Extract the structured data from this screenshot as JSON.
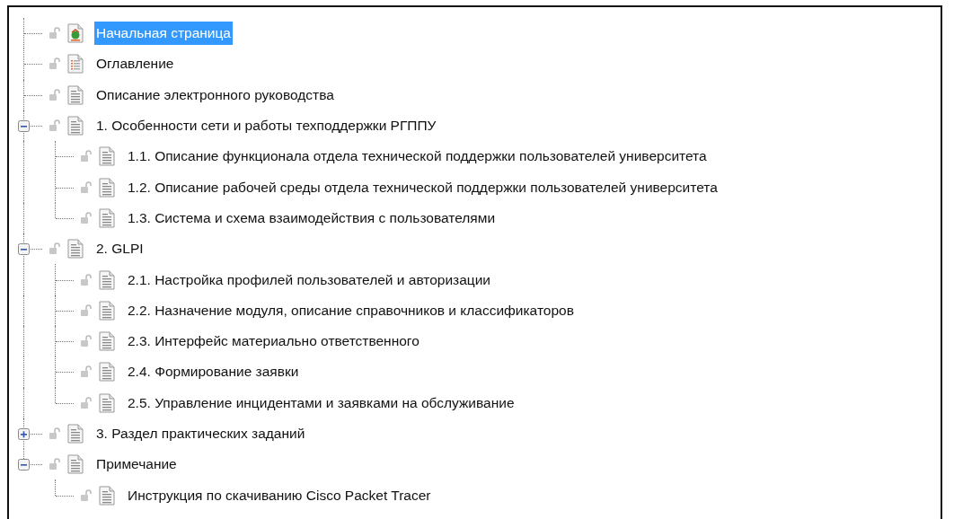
{
  "tree": [
    {
      "label": "Начальная страница",
      "kind": "home",
      "selected": true
    },
    {
      "label": "Оглавление",
      "kind": "contents",
      "selected": false
    },
    {
      "label": "Описание электронного руководства",
      "kind": "page",
      "selected": false
    },
    {
      "label": "1. Особенности сети и работы техподдержки РГППУ",
      "kind": "page",
      "selected": false,
      "expanded": true,
      "children": [
        {
          "label": "1.1. Описание функционала отдела технической поддержки пользователей университета",
          "kind": "page",
          "selected": false
        },
        {
          "label": "1.2. Описание рабочей среды  отдела технической поддержки пользователей университета",
          "kind": "page",
          "selected": false
        },
        {
          "label": "1.3. Система и схема взаимодействия с пользователями",
          "kind": "page",
          "selected": false
        }
      ]
    },
    {
      "label": "2. GLPI",
      "kind": "page",
      "selected": false,
      "expanded": true,
      "children": [
        {
          "label": "2.1. Настройка профилей пользователей и авторизации",
          "kind": "page",
          "selected": false
        },
        {
          "label": "2.2. Назначение модуля, описание справочников и классификаторов",
          "kind": "page",
          "selected": false
        },
        {
          "label": "2.3. Интерфейс материально ответственного",
          "kind": "page",
          "selected": false
        },
        {
          "label": "2.4. Формирование заявки",
          "kind": "page",
          "selected": false
        },
        {
          "label": "2.5. Управление инцидентами и заявками на обслуживание",
          "kind": "page",
          "selected": false
        }
      ]
    },
    {
      "label": "3. Раздел практических заданий",
      "kind": "page",
      "selected": false,
      "expanded": false
    },
    {
      "label": "Примечание",
      "kind": "page",
      "selected": false,
      "expanded": true,
      "children": [
        {
          "label": "Инструкция по скачиванию Cisco Packet Tracer",
          "kind": "page",
          "selected": false
        }
      ]
    }
  ]
}
